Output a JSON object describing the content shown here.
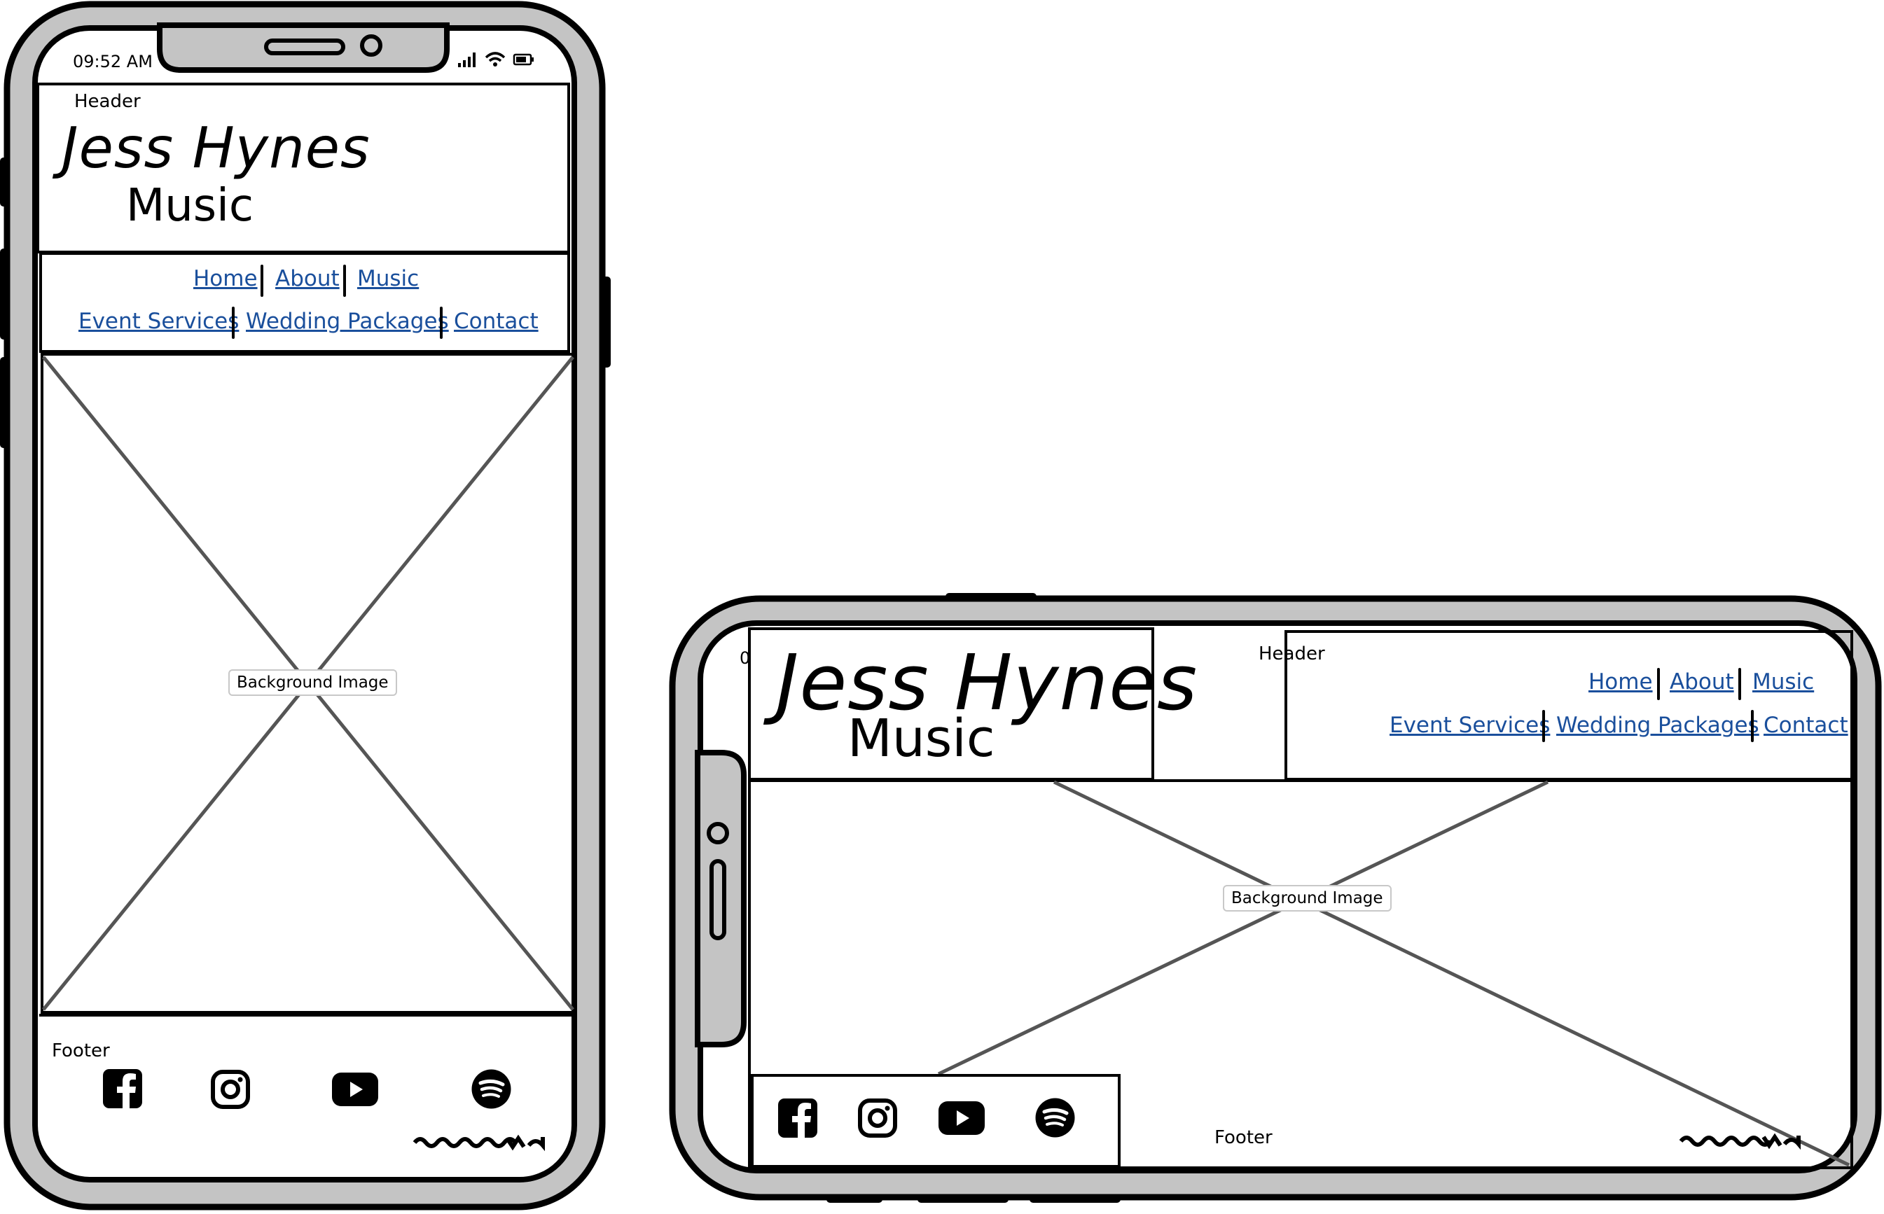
{
  "portrait": {
    "status_time": "09:52 AM",
    "header_label": "Header",
    "title_line1": "Jess Hynes",
    "title_line2": "Music",
    "nav": {
      "home": "Home",
      "about": "About",
      "music": "Music",
      "event_services": "Event Services",
      "wedding_packages": "Wedding Packages",
      "contact": "Contact"
    },
    "hero_label": "Background Image",
    "footer_label": "Footer",
    "social_icons": [
      "facebook-icon",
      "instagram-icon",
      "youtube-icon",
      "spotify-icon"
    ]
  },
  "landscape": {
    "status_time_partial": "0",
    "header_label": "Header",
    "title_line1": "Jess Hynes",
    "title_line2": "Music",
    "nav": {
      "home": "Home",
      "about": "About",
      "music": "Music",
      "event_services": "Event Services",
      "wedding_packages": "Wedding Packages",
      "contact": "Contact"
    },
    "hero_label": "Background Image",
    "footer_label": "Footer",
    "social_icons": [
      "facebook-icon",
      "instagram-icon",
      "youtube-icon",
      "spotify-icon"
    ]
  },
  "colors": {
    "link": "#1a4f9c",
    "device_body": "#c4c4c4",
    "placeholder_line": "#555555"
  }
}
